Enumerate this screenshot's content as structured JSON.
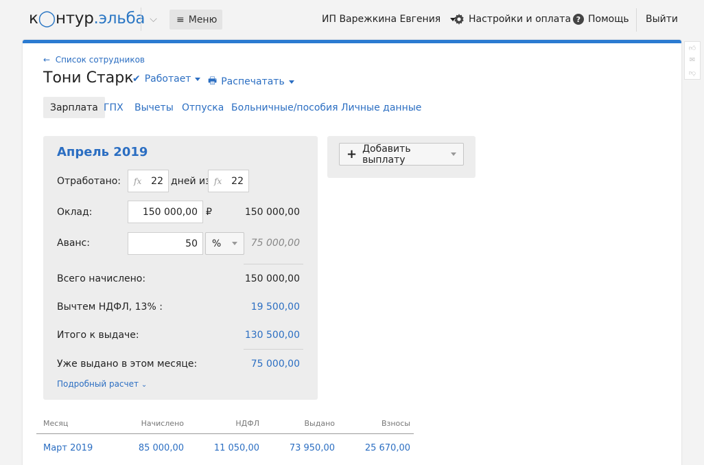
{
  "header": {
    "logo_part1": "к",
    "logo_part2": "нтур",
    "logo_part3": ".эльба",
    "menu_label": "Меню",
    "company": "ИП Варежкина Евгения",
    "settings_label": "Настройки и оплата",
    "help_label": "Помощь",
    "logout_label": "Выйти"
  },
  "employee": {
    "back_label": "Список сотрудников",
    "name": "Тони Старк",
    "status_label": "Работает",
    "print_label": "Распечатать"
  },
  "tabs": [
    {
      "label": "Зарплата",
      "active": true
    },
    {
      "label": "ГПХ",
      "active": false
    },
    {
      "label": "Вычеты",
      "active": false
    },
    {
      "label": "Отпуска",
      "active": false
    },
    {
      "label": "Больничные/пособия",
      "active": false
    },
    {
      "label": "Личные данные",
      "active": false
    }
  ],
  "salary": {
    "period": "Апрель 2019",
    "worked_label": "Отработано:",
    "worked_days": "22",
    "days_of_label": "дней из",
    "total_days": "22",
    "fx_symbol": "𝑓x",
    "salary_label": "Оклад:",
    "salary_input": "150 000,00",
    "currency": "₽",
    "salary_amount": "150 000,00",
    "advance_label": "Аванс:",
    "advance_input": "50",
    "advance_unit": "%",
    "advance_amount": "75 000,00",
    "total_accrued_label": "Всего начислено:",
    "total_accrued": "150 000,00",
    "ndfl_label": "Вычтем НДФЛ, 13% :",
    "ndfl": "19 500,00",
    "payout_label": "Итого к выдаче:",
    "payout": "130 500,00",
    "paid_label": "Уже выдано в этом месяце:",
    "paid": "75 000,00",
    "details_label": "Подробный расчет"
  },
  "add_payment_label": "Добавить выплату",
  "history": {
    "columns": [
      "Месяц",
      "Начислено",
      "НДФЛ",
      "Выдано",
      "Взносы"
    ],
    "rows": [
      [
        "Март 2019",
        "85 000,00",
        "11 050,00",
        "73 950,00",
        "25 670,00"
      ]
    ]
  },
  "colors": {
    "accent": "#2b7bd1",
    "link": "#2b6ec2"
  }
}
